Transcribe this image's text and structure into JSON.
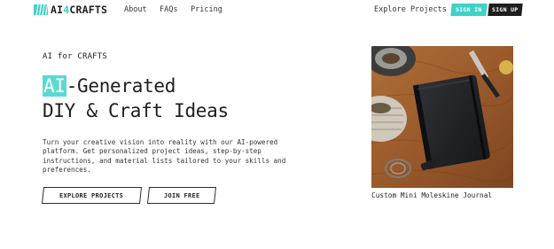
{
  "nav": {
    "logo_text": "AI",
    "logo_four": "4",
    "logo_rest": "CRAFTS",
    "links": [
      "About",
      "FAQs",
      "Pricing"
    ],
    "explore_link": "Explore Projects",
    "signin_label": "SIGN IN",
    "signup_label": "SIGN UP"
  },
  "hero": {
    "eyebrow": "AI for CRAFTS",
    "headline_highlight": "AI",
    "headline_line1_rest": "-Generated",
    "headline_line2": "DIY & Craft Ideas",
    "description": "Turn your creative vision into reality with our AI-powered platform. Get personalized project ideas, step-by-step instructions, and material lists tailored to your skills and preferences.",
    "explore_button": "EXPLORE PROJECTS",
    "join_button": "JOIN FREE"
  },
  "feature": {
    "caption": "Custom Mini Moleskine Journal"
  },
  "colors": {
    "accent": "#41d1c8",
    "dark": "#1e1e1e"
  }
}
